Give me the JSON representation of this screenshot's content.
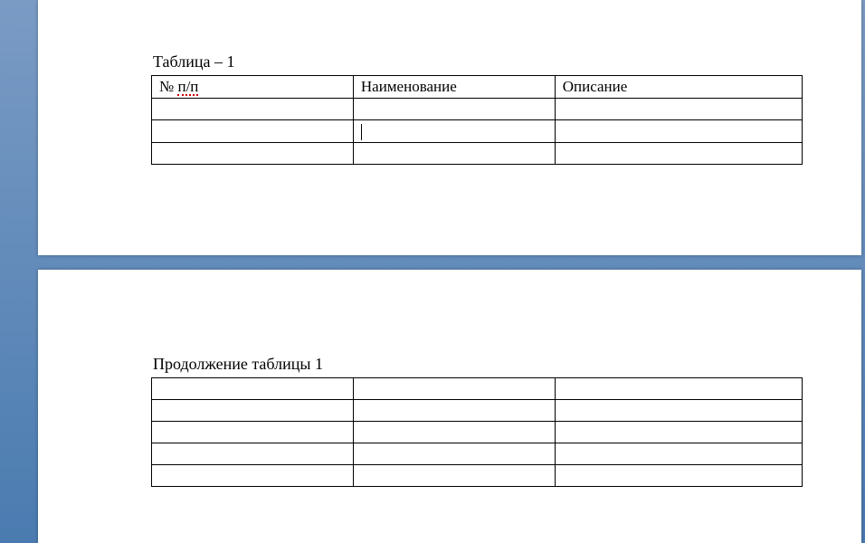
{
  "page1": {
    "caption_prefix": "Таблица",
    "caption_suffix": " – 1",
    "table": {
      "headers": {
        "col1_prefix": "№ ",
        "col1_underlined": "п/п",
        "col2": "Наименование",
        "col3": "Описание"
      },
      "rows": [
        {
          "c1": "",
          "c2": "",
          "c3": ""
        },
        {
          "c1": "",
          "c2": "",
          "c3": "",
          "cursor_in_c2": true
        },
        {
          "c1": "",
          "c2": "",
          "c3": ""
        }
      ]
    }
  },
  "page2": {
    "caption": "Продолжение таблицы 1",
    "table": {
      "rows": [
        {
          "c1": "",
          "c2": "",
          "c3": ""
        },
        {
          "c1": "",
          "c2": "",
          "c3": ""
        },
        {
          "c1": "",
          "c2": "",
          "c3": ""
        },
        {
          "c1": "",
          "c2": "",
          "c3": ""
        },
        {
          "c1": "",
          "c2": "",
          "c3": ""
        }
      ]
    }
  }
}
